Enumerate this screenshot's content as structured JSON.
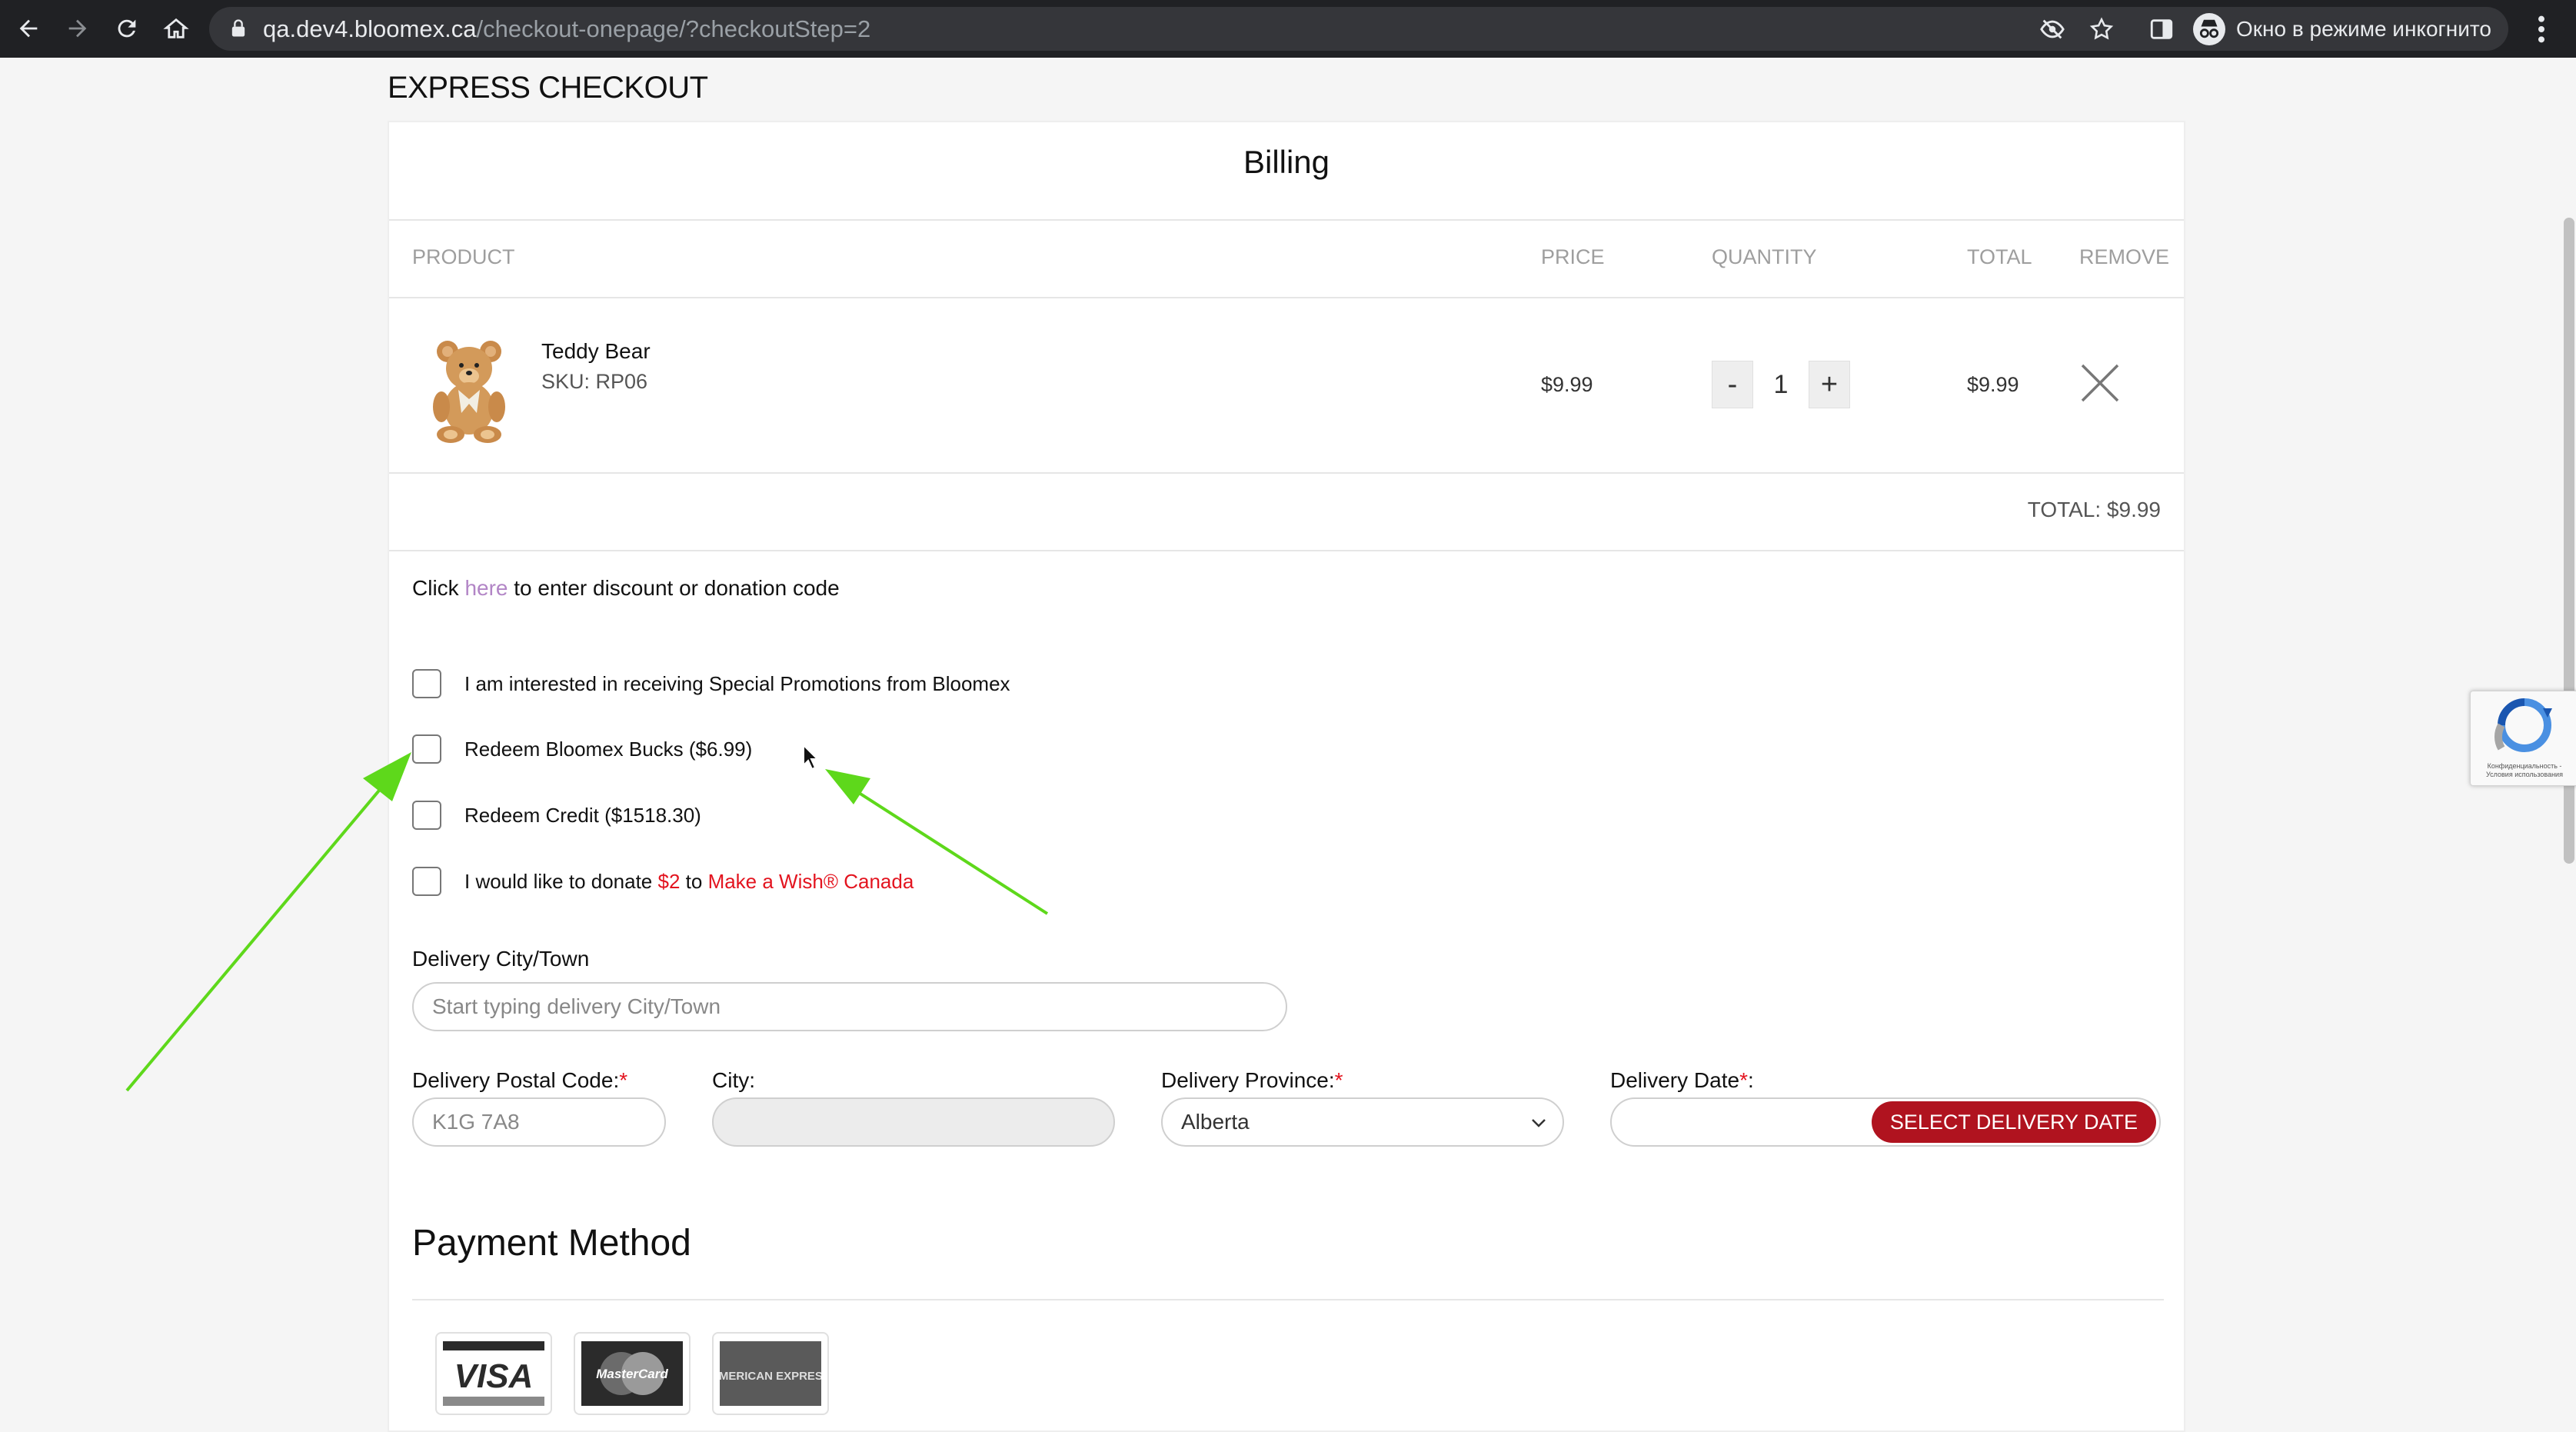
{
  "browser": {
    "url_host": "qa.dev4.bloomex.ca",
    "url_path": "/checkout-onepage/?checkoutStep=2",
    "incognito_label": "Окно в режиме инкогнито"
  },
  "page": {
    "title": "EXPRESS CHECKOUT",
    "card_title": "Billing"
  },
  "table": {
    "headers": [
      "PRODUCT",
      "PRICE",
      "QUANTITY",
      "TOTAL",
      "REMOVE"
    ],
    "items": [
      {
        "name": "Teddy Bear",
        "sku": "SKU: RP06",
        "price": "$9.99",
        "quantity": "1",
        "total": "$9.99",
        "minus": "-",
        "plus": "+"
      }
    ],
    "grand_total": "TOTAL: $9.99"
  },
  "discount": {
    "prefix": "Click ",
    "link": "here",
    "suffix": " to enter discount or donation code"
  },
  "options": [
    {
      "label": "I am interested in receiving Special Promotions from Bloomex",
      "checked": false
    },
    {
      "label": "Redeem Bloomex Bucks ($6.99)",
      "checked": false
    },
    {
      "label": "Redeem Credit ($1518.30)",
      "checked": false
    }
  ],
  "donate": {
    "prefix": "I would like to donate ",
    "amount": "$2",
    "mid": " to ",
    "org": "Make a Wish® Canada",
    "checked": false
  },
  "form": {
    "city_town_label": "Delivery City/Town",
    "city_town_placeholder": "Start typing delivery City/Town",
    "postal_label": "Delivery Postal Code:",
    "postal_placeholder": "K1G 7A8",
    "city_label": "City:",
    "province_label": "Delivery Province:",
    "province_value": "Alberta",
    "date_label": "Delivery Date",
    "date_label_suffix": ":",
    "required_mark": "*",
    "select_date_button": "SELECT DELIVERY DATE"
  },
  "payment": {
    "title": "Payment Method",
    "logos": [
      "VISA",
      "MasterCard",
      "AMERICAN EXPRESS"
    ]
  },
  "recaptcha": {
    "text": "Конфиденциальность - Условия использования"
  },
  "colors": {
    "accent_red": "#e3141f",
    "button_red": "#b0131f",
    "link_purple": "#b285c6",
    "annotation_green": "#5ed81b"
  }
}
